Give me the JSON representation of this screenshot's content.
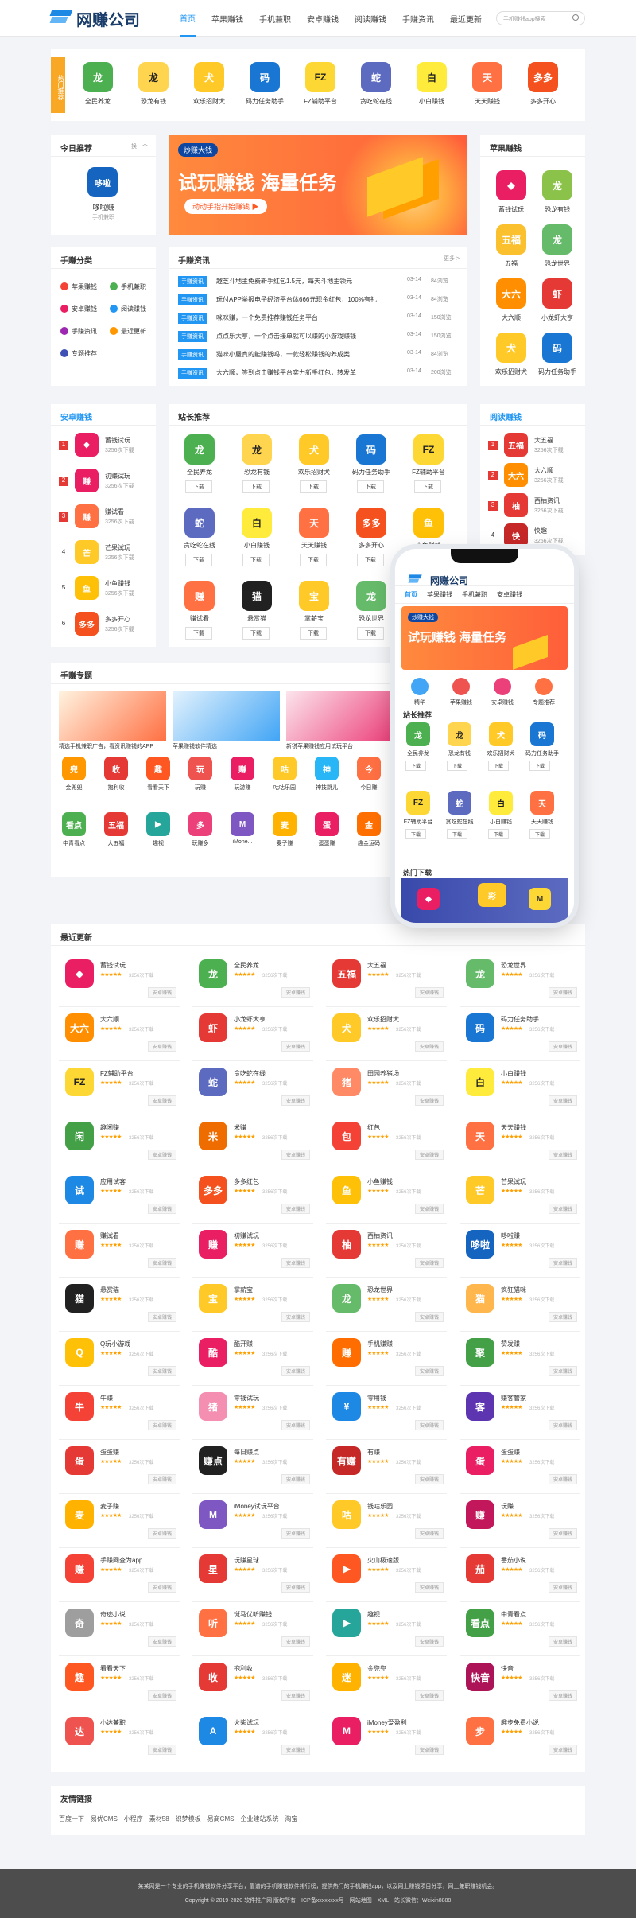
{
  "header": {
    "brand": "网赚公司",
    "nav": [
      "首页",
      "苹果赚钱",
      "手机兼职",
      "安卓赚钱",
      "阅读赚钱",
      "手赚资讯",
      "最近更新"
    ],
    "search_placeholder": "手机赚钱app搜索"
  },
  "hot": {
    "tag": "热门推荐",
    "items": [
      {
        "name": "全民养龙",
        "c": "#4caf50",
        "g": "龙"
      },
      {
        "name": "恐龙有钱",
        "c": "#ffd54f",
        "g": "龙"
      },
      {
        "name": "欢乐招财犬",
        "c": "#ffca28",
        "g": "犬"
      },
      {
        "name": "码力任务助手",
        "c": "#1976d2",
        "g": "码"
      },
      {
        "name": "FZ辅助平台",
        "c": "#fdd835",
        "g": "FZ"
      },
      {
        "name": "贪吃蛇在线",
        "c": "#5c6bc0",
        "g": "蛇"
      },
      {
        "name": "小白赚钱",
        "c": "#ffeb3b",
        "g": "白"
      },
      {
        "name": "天天赚钱",
        "c": "#ff7043",
        "g": "天"
      },
      {
        "name": "多多开心",
        "c": "#f4511e",
        "g": "多多"
      }
    ]
  },
  "today": {
    "title": "今日推荐",
    "more": "换一个",
    "app": "哆啦赚",
    "sub": "手机兼职",
    "g": "哆啦"
  },
  "banner": {
    "brand": "炒赚大钱",
    "line1": "试玩赚钱",
    "line2": "海量任务",
    "cta": "动动手指开始赚钱 ▶"
  },
  "apple": {
    "title": "苹果赚钱",
    "items": [
      {
        "name": "蓄钱试玩",
        "c": "#e91e63",
        "g": "◆"
      },
      {
        "name": "恐龙有钱",
        "c": "#8bc34a",
        "g": "龙"
      },
      {
        "name": "五福",
        "c": "#fbc02d",
        "g": "五福"
      },
      {
        "name": "恐龙世界",
        "c": "#66bb6a",
        "g": "龙"
      },
      {
        "name": "大六顺",
        "c": "#ff8f00",
        "g": "大六"
      },
      {
        "name": "小龙虾大亨",
        "c": "#e53935",
        "g": "虾"
      },
      {
        "name": "欢乐招财犬",
        "c": "#ffca28",
        "g": "犬"
      },
      {
        "name": "码力任务助手",
        "c": "#1976d2",
        "g": "码"
      }
    ]
  },
  "cat": {
    "title": "手赚分类",
    "items": [
      {
        "name": "苹果赚钱",
        "c": "#f44336"
      },
      {
        "name": "手机兼职",
        "c": "#4caf50"
      },
      {
        "name": "安卓赚钱",
        "c": "#e91e63"
      },
      {
        "name": "阅读赚钱",
        "c": "#2196f3"
      },
      {
        "name": "手赚资讯",
        "c": "#9c27b0"
      },
      {
        "name": "最近更新",
        "c": "#ff9800"
      },
      {
        "name": "专题推荐",
        "c": "#3f51b5"
      }
    ]
  },
  "news": {
    "title": "手赚资讯",
    "more": "更多 >",
    "tag": "手赚资讯",
    "rows": [
      {
        "t": "趣芝斗地主免费新手红包1.5元，每天斗地主领元",
        "d": "03-14",
        "v": "84浏览"
      },
      {
        "t": "玩付APP举报电子经济平台体666元现金红包，100%有礼",
        "d": "03-14",
        "v": "84浏览"
      },
      {
        "t": "咪咪赚，一个免费推荐赚钱任务平台",
        "d": "03-14",
        "v": "150浏览"
      },
      {
        "t": "点点乐大亨，一个点击接单就可以赚的小游戏赚钱",
        "d": "03-14",
        "v": "150浏览"
      },
      {
        "t": "猫咪小屋真的能赚钱吗，一款轻松赚钱的养成类",
        "d": "03-14",
        "v": "84浏览"
      },
      {
        "t": "大六顺，签到点击赚钱平台实力新手红包，转发单",
        "d": "03-14",
        "v": "200浏览"
      }
    ]
  },
  "android": {
    "title": "安卓赚钱",
    "items": [
      {
        "name": "蓄钱试玩",
        "c": "#e91e63",
        "g": "◆",
        "n": "3256次下载"
      },
      {
        "name": "初赚试玩",
        "c": "#e91e63",
        "g": "赚",
        "n": "3256次下载"
      },
      {
        "name": "赚试看",
        "c": "#ff7043",
        "g": "赚",
        "n": "3256次下载"
      },
      {
        "name": "芒果试玩",
        "c": "#ffca28",
        "g": "芒",
        "n": "3256次下载"
      },
      {
        "name": "小鱼赚钱",
        "c": "#ffc107",
        "g": "鱼",
        "n": "3256次下载"
      },
      {
        "name": "多多开心",
        "c": "#f4511e",
        "g": "多多",
        "n": "3256次下载"
      }
    ]
  },
  "rank": {
    "title": "站长推荐",
    "dl": "下载",
    "items": [
      {
        "name": "全民养龙",
        "c": "#4caf50",
        "g": "龙"
      },
      {
        "name": "恐龙有钱",
        "c": "#ffd54f",
        "g": "龙"
      },
      {
        "name": "欢乐招财犬",
        "c": "#ffca28",
        "g": "犬"
      },
      {
        "name": "码力任务助手",
        "c": "#1976d2",
        "g": "码"
      },
      {
        "name": "FZ辅助平台",
        "c": "#fdd835",
        "g": "FZ"
      },
      {
        "name": "贪吃蛇在线",
        "c": "#5c6bc0",
        "g": "蛇"
      },
      {
        "name": "小白赚钱",
        "c": "#ffeb3b",
        "g": "白"
      },
      {
        "name": "天天赚钱",
        "c": "#ff7043",
        "g": "天"
      },
      {
        "name": "多多开心",
        "c": "#f4511e",
        "g": "多多"
      },
      {
        "name": "小鱼赚钱",
        "c": "#ffc107",
        "g": "鱼"
      },
      {
        "name": "赚试看",
        "c": "#ff7043",
        "g": "赚"
      },
      {
        "name": "悬赏猫",
        "c": "#212121",
        "g": "猫"
      },
      {
        "name": "掌薪宝",
        "c": "#ffca28",
        "g": "宝"
      },
      {
        "name": "恐龙世界",
        "c": "#66bb6a",
        "g": "龙"
      }
    ]
  },
  "reading": {
    "title": "阅读赚钱",
    "items": [
      {
        "name": "大五福",
        "c": "#e53935",
        "g": "五福",
        "n": "3256次下载"
      },
      {
        "name": "大六顺",
        "c": "#ff8f00",
        "g": "大六",
        "n": "3256次下载"
      },
      {
        "name": "西柚资讯",
        "c": "#e53935",
        "g": "柚",
        "n": "3256次下载"
      },
      {
        "name": "快趣",
        "c": "#c62828",
        "g": "快",
        "n": "3256次下载"
      }
    ]
  },
  "topic": {
    "title": "手赚专题",
    "cards": [
      "精选手机兼职广告，看资讯赚钱的APP",
      "苹果赚钱软件精选",
      "新锐苹果赚钱应用试玩平台"
    ],
    "items": [
      {
        "name": "金兜兜",
        "c": "#ff9800",
        "g": "兜"
      },
      {
        "name": "抱利收",
        "c": "#e53935",
        "g": "收"
      },
      {
        "name": "看看天下",
        "c": "#ff5722",
        "g": "趣"
      },
      {
        "name": "玩赚",
        "c": "#ef5350",
        "g": "玩"
      },
      {
        "name": "玩游赚",
        "c": "#e91e63",
        "g": "赚"
      },
      {
        "name": "咕咕乐园",
        "c": "#ffca28",
        "g": "咕"
      },
      {
        "name": "神技跳儿",
        "c": "#29b6f6",
        "g": "神"
      },
      {
        "name": "今日赚",
        "c": "#ff7043",
        "g": "今"
      },
      {
        "name": "中青看点",
        "c": "#4caf50",
        "g": "看点"
      },
      {
        "name": "大五福",
        "c": "#e53935",
        "g": "五福"
      },
      {
        "name": "趣视",
        "c": "#26a69a",
        "g": "▶"
      },
      {
        "name": "玩赚多",
        "c": "#ec407a",
        "g": "多"
      },
      {
        "name": "iMone...",
        "c": "#7e57c2",
        "g": "M"
      },
      {
        "name": "麦子赚",
        "c": "#ffb300",
        "g": "麦"
      },
      {
        "name": "蛋蛋赚",
        "c": "#e91e63",
        "g": "蛋"
      },
      {
        "name": "趣金运码",
        "c": "#ff6f00",
        "g": "金"
      },
      {
        "name": "赚客",
        "c": "#c2185b",
        "g": "赚"
      }
    ]
  },
  "latest": {
    "title": "最近更新",
    "tag": "安卓赚钱",
    "stars": "★★★★★",
    "count": "3256次下载",
    "items": [
      {
        "name": "蓄钱试玩",
        "c": "#e91e63",
        "g": "◆"
      },
      {
        "name": "全民养龙",
        "c": "#4caf50",
        "g": "龙"
      },
      {
        "name": "大五福",
        "c": "#e53935",
        "g": "五福"
      },
      {
        "name": "恐龙世界",
        "c": "#66bb6a",
        "g": "龙"
      },
      {
        "name": "大六顺",
        "c": "#ff8f00",
        "g": "大六"
      },
      {
        "name": "小龙虾大亨",
        "c": "#e53935",
        "g": "虾"
      },
      {
        "name": "欢乐招财犬",
        "c": "#ffca28",
        "g": "犬"
      },
      {
        "name": "码力任务助手",
        "c": "#1976d2",
        "g": "码"
      },
      {
        "name": "FZ辅助平台",
        "c": "#fdd835",
        "g": "FZ"
      },
      {
        "name": "贪吃蛇在线",
        "c": "#5c6bc0",
        "g": "蛇"
      },
      {
        "name": "田园养猪场",
        "c": "#ff8a65",
        "g": "猪"
      },
      {
        "name": "小白赚钱",
        "c": "#ffeb3b",
        "g": "白"
      },
      {
        "name": "趣闲赚",
        "c": "#43a047",
        "g": "闲"
      },
      {
        "name": "米赚",
        "c": "#ef6c00",
        "g": "米"
      },
      {
        "name": "红包",
        "c": "#f44336",
        "g": "包"
      },
      {
        "name": "天天赚钱",
        "c": "#ff7043",
        "g": "天"
      },
      {
        "name": "应用试客",
        "c": "#1e88e5",
        "g": "试"
      },
      {
        "name": "多多红包",
        "c": "#f4511e",
        "g": "多多"
      },
      {
        "name": "小鱼赚钱",
        "c": "#ffc107",
        "g": "鱼"
      },
      {
        "name": "芒果试玩",
        "c": "#ffca28",
        "g": "芒"
      },
      {
        "name": "赚试看",
        "c": "#ff7043",
        "g": "赚"
      },
      {
        "name": "初赚试玩",
        "c": "#e91e63",
        "g": "赚"
      },
      {
        "name": "西柚资讯",
        "c": "#e53935",
        "g": "柚"
      },
      {
        "name": "哆啦赚",
        "c": "#1565c0",
        "g": "哆啦"
      },
      {
        "name": "悬赏猫",
        "c": "#212121",
        "g": "猫"
      },
      {
        "name": "掌薪宝",
        "c": "#ffca28",
        "g": "宝"
      },
      {
        "name": "恐龙世界",
        "c": "#66bb6a",
        "g": "龙"
      },
      {
        "name": "疯狂猫咪",
        "c": "#ffb74d",
        "g": "猫"
      },
      {
        "name": "Q玩小游戏",
        "c": "#ffc107",
        "g": "Q"
      },
      {
        "name": "酷开赚",
        "c": "#e91e63",
        "g": "酷"
      },
      {
        "name": "手机赚赚",
        "c": "#ff6d00",
        "g": "赚"
      },
      {
        "name": "赞发赚",
        "c": "#43a047",
        "g": "聚"
      },
      {
        "name": "牛赚",
        "c": "#f44336",
        "g": "牛"
      },
      {
        "name": "零钱试玩",
        "c": "#f48fb1",
        "g": "猪"
      },
      {
        "name": "零用钱",
        "c": "#1e88e5",
        "g": "¥"
      },
      {
        "name": "赚客管家",
        "c": "#5e35b1",
        "g": "客"
      },
      {
        "name": "蛋蛋赚",
        "c": "#e53935",
        "g": "蛋"
      },
      {
        "name": "每日赚点",
        "c": "#212121",
        "g": "赚点"
      },
      {
        "name": "有赚",
        "c": "#c62828",
        "g": "有赚"
      },
      {
        "name": "蛋蛋赚",
        "c": "#e91e63",
        "g": "蛋"
      },
      {
        "name": "麦子赚",
        "c": "#ffb300",
        "g": "麦"
      },
      {
        "name": "iMoney试玩平台",
        "c": "#7e57c2",
        "g": "M"
      },
      {
        "name": "钱咕乐园",
        "c": "#ffca28",
        "g": "咕"
      },
      {
        "name": "玩赚",
        "c": "#c2185b",
        "g": "赚"
      },
      {
        "name": "手赚网查为app",
        "c": "#f44336",
        "g": "赚"
      },
      {
        "name": "玩赚星球",
        "c": "#e53935",
        "g": "星"
      },
      {
        "name": "火山极速版",
        "c": "#ff5722",
        "g": "▶"
      },
      {
        "name": "番茄小说",
        "c": "#e53935",
        "g": "茄"
      },
      {
        "name": "奇迹小说",
        "c": "#9e9e9e",
        "g": "奇"
      },
      {
        "name": "斑马优听赚钱",
        "c": "#ff7043",
        "g": "听"
      },
      {
        "name": "趣视",
        "c": "#26a69a",
        "g": "▶"
      },
      {
        "name": "中青看点",
        "c": "#43a047",
        "g": "看点"
      },
      {
        "name": "看看天下",
        "c": "#ff5722",
        "g": "趣"
      },
      {
        "name": "抱利收",
        "c": "#e53935",
        "g": "收"
      },
      {
        "name": "金兜兜",
        "c": "#ffb300",
        "g": "迷"
      },
      {
        "name": "快音",
        "c": "#ad1457",
        "g": "快音"
      },
      {
        "name": "小达兼职",
        "c": "#ef5350",
        "g": "达"
      },
      {
        "name": "火柴试玩",
        "c": "#1e88e5",
        "g": "A"
      },
      {
        "name": "iMoney爱盈利",
        "c": "#e91e63",
        "g": "M"
      },
      {
        "name": "趣步免费小说",
        "c": "#ff7043",
        "g": "步"
      }
    ]
  },
  "links": {
    "title": "友情链接",
    "items": [
      "百度一下",
      "易优CMS",
      "小程序",
      "素材58",
      "织梦模板",
      "易商CMS",
      "企业建站系统",
      "淘宝"
    ]
  },
  "footer": {
    "line1": "某某网是一个专业的手机赚钱软件分享平台，靠谱的手机赚钱软件排行榜，提供热门的手机赚钱app，以及网上赚钱项目分享，网上兼职赚钱机会。",
    "line2": "Copyright © 2019-2020 软件推广网 版权所有　ICP备xxxxxxxx号　网站地图　XML　站长微信：Weixin8888"
  },
  "phone": {
    "tabs": [
      "首页",
      "苹果赚钱",
      "手机兼职",
      "安卓赚钱"
    ],
    "banner1": "炒赚大钱",
    "banner2": "试玩赚钱 海量任务",
    "cats": [
      "精华",
      "苹果赚钱",
      "安卓赚钱",
      "专题推荐"
    ],
    "rank": "站长推荐",
    "hot": "热门下载",
    "dl": "下载",
    "apps": [
      {
        "name": "全民养龙",
        "c": "#4caf50",
        "g": "龙"
      },
      {
        "name": "恐龙有钱",
        "c": "#ffd54f",
        "g": "龙"
      },
      {
        "name": "欢乐招财犬",
        "c": "#ffca28",
        "g": "犬"
      },
      {
        "name": "码力任务助手",
        "c": "#1976d2",
        "g": "码"
      },
      {
        "name": "FZ辅助平台",
        "c": "#fdd835",
        "g": "FZ"
      },
      {
        "name": "贪吃蛇在线",
        "c": "#5c6bc0",
        "g": "蛇"
      },
      {
        "name": "小白赚钱",
        "c": "#ffeb3b",
        "g": "白"
      },
      {
        "name": "天天赚钱",
        "c": "#ff7043",
        "g": "天"
      }
    ]
  }
}
